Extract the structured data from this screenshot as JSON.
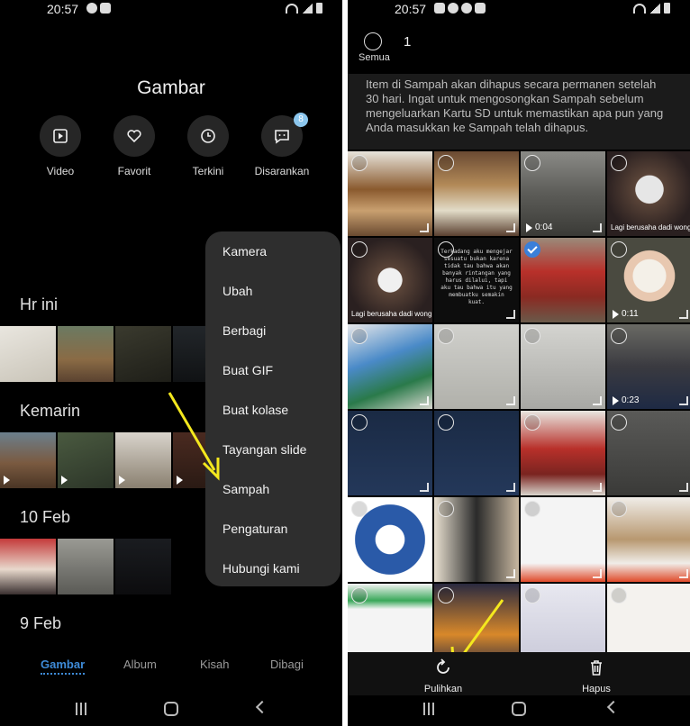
{
  "left": {
    "status": {
      "time": "20:57"
    },
    "title": "Gambar",
    "quick_actions": [
      {
        "label": "Video",
        "icon": "video-icon"
      },
      {
        "label": "Favorit",
        "icon": "heart-icon"
      },
      {
        "label": "Terkini",
        "icon": "clock-icon"
      },
      {
        "label": "Disarankan",
        "icon": "suggest-icon",
        "badge": "8"
      }
    ],
    "sections": [
      "Hr ini",
      "Kemarin",
      "10 Feb",
      "9 Feb"
    ],
    "menu": [
      "Kamera",
      "Ubah",
      "Berbagi",
      "Buat GIF",
      "Buat kolase",
      "Tayangan slide",
      "Sampah",
      "Pengaturan",
      "Hubungi kami"
    ],
    "tabs": [
      "Gambar",
      "Album",
      "Kisah",
      "Dibagi"
    ],
    "active_tab": "Gambar"
  },
  "right": {
    "status": {
      "time": "20:57"
    },
    "select_all_label": "Semua",
    "selected_count": "1",
    "notice": "Item di Sampah akan dihapus secara permanen setelah 30 hari. Ingat untuk mengosongkan Sampah sebelum mengeluarkan Kartu SD untuk memastikan apa pun yang Anda masukkan ke Sampah telah dihapus.",
    "grid": {
      "video_durations": [
        "0:04",
        "0:11",
        "0:23"
      ],
      "caption": "Lagi berusaha dadi wong",
      "story_text": "Terkadang aku mengejar sesuatu bukan karena tidak tau bahwa akan banyak rintangan yang harus dilalui, tapi aku tau bahwa itu yang membuatku semakin kuat."
    },
    "actions": [
      {
        "label": "Pulihkan",
        "icon": "restore-icon"
      },
      {
        "label": "Hapus",
        "icon": "trash-icon"
      }
    ]
  },
  "colors": {
    "accent": "#3e8bd8",
    "annotation_arrow": "#f4e81e",
    "menu_bg": "#2e2e2e"
  }
}
